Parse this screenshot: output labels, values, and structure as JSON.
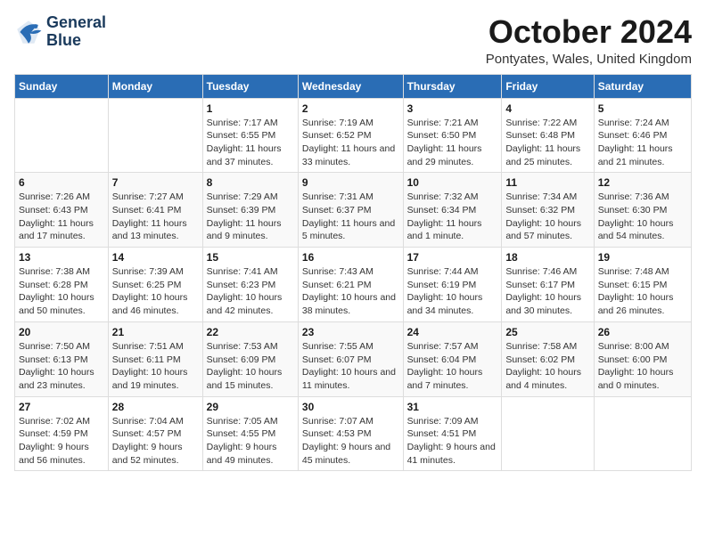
{
  "logo": {
    "line1": "General",
    "line2": "Blue"
  },
  "title": "October 2024",
  "subtitle": "Pontyates, Wales, United Kingdom",
  "days_of_week": [
    "Sunday",
    "Monday",
    "Tuesday",
    "Wednesday",
    "Thursday",
    "Friday",
    "Saturday"
  ],
  "weeks": [
    [
      {
        "day": "",
        "info": ""
      },
      {
        "day": "",
        "info": ""
      },
      {
        "day": "1",
        "info": "Sunrise: 7:17 AM\nSunset: 6:55 PM\nDaylight: 11 hours and 37 minutes."
      },
      {
        "day": "2",
        "info": "Sunrise: 7:19 AM\nSunset: 6:52 PM\nDaylight: 11 hours and 33 minutes."
      },
      {
        "day": "3",
        "info": "Sunrise: 7:21 AM\nSunset: 6:50 PM\nDaylight: 11 hours and 29 minutes."
      },
      {
        "day": "4",
        "info": "Sunrise: 7:22 AM\nSunset: 6:48 PM\nDaylight: 11 hours and 25 minutes."
      },
      {
        "day": "5",
        "info": "Sunrise: 7:24 AM\nSunset: 6:46 PM\nDaylight: 11 hours and 21 minutes."
      }
    ],
    [
      {
        "day": "6",
        "info": "Sunrise: 7:26 AM\nSunset: 6:43 PM\nDaylight: 11 hours and 17 minutes."
      },
      {
        "day": "7",
        "info": "Sunrise: 7:27 AM\nSunset: 6:41 PM\nDaylight: 11 hours and 13 minutes."
      },
      {
        "day": "8",
        "info": "Sunrise: 7:29 AM\nSunset: 6:39 PM\nDaylight: 11 hours and 9 minutes."
      },
      {
        "day": "9",
        "info": "Sunrise: 7:31 AM\nSunset: 6:37 PM\nDaylight: 11 hours and 5 minutes."
      },
      {
        "day": "10",
        "info": "Sunrise: 7:32 AM\nSunset: 6:34 PM\nDaylight: 11 hours and 1 minute."
      },
      {
        "day": "11",
        "info": "Sunrise: 7:34 AM\nSunset: 6:32 PM\nDaylight: 10 hours and 57 minutes."
      },
      {
        "day": "12",
        "info": "Sunrise: 7:36 AM\nSunset: 6:30 PM\nDaylight: 10 hours and 54 minutes."
      }
    ],
    [
      {
        "day": "13",
        "info": "Sunrise: 7:38 AM\nSunset: 6:28 PM\nDaylight: 10 hours and 50 minutes."
      },
      {
        "day": "14",
        "info": "Sunrise: 7:39 AM\nSunset: 6:25 PM\nDaylight: 10 hours and 46 minutes."
      },
      {
        "day": "15",
        "info": "Sunrise: 7:41 AM\nSunset: 6:23 PM\nDaylight: 10 hours and 42 minutes."
      },
      {
        "day": "16",
        "info": "Sunrise: 7:43 AM\nSunset: 6:21 PM\nDaylight: 10 hours and 38 minutes."
      },
      {
        "day": "17",
        "info": "Sunrise: 7:44 AM\nSunset: 6:19 PM\nDaylight: 10 hours and 34 minutes."
      },
      {
        "day": "18",
        "info": "Sunrise: 7:46 AM\nSunset: 6:17 PM\nDaylight: 10 hours and 30 minutes."
      },
      {
        "day": "19",
        "info": "Sunrise: 7:48 AM\nSunset: 6:15 PM\nDaylight: 10 hours and 26 minutes."
      }
    ],
    [
      {
        "day": "20",
        "info": "Sunrise: 7:50 AM\nSunset: 6:13 PM\nDaylight: 10 hours and 23 minutes."
      },
      {
        "day": "21",
        "info": "Sunrise: 7:51 AM\nSunset: 6:11 PM\nDaylight: 10 hours and 19 minutes."
      },
      {
        "day": "22",
        "info": "Sunrise: 7:53 AM\nSunset: 6:09 PM\nDaylight: 10 hours and 15 minutes."
      },
      {
        "day": "23",
        "info": "Sunrise: 7:55 AM\nSunset: 6:07 PM\nDaylight: 10 hours and 11 minutes."
      },
      {
        "day": "24",
        "info": "Sunrise: 7:57 AM\nSunset: 6:04 PM\nDaylight: 10 hours and 7 minutes."
      },
      {
        "day": "25",
        "info": "Sunrise: 7:58 AM\nSunset: 6:02 PM\nDaylight: 10 hours and 4 minutes."
      },
      {
        "day": "26",
        "info": "Sunrise: 8:00 AM\nSunset: 6:00 PM\nDaylight: 10 hours and 0 minutes."
      }
    ],
    [
      {
        "day": "27",
        "info": "Sunrise: 7:02 AM\nSunset: 4:59 PM\nDaylight: 9 hours and 56 minutes."
      },
      {
        "day": "28",
        "info": "Sunrise: 7:04 AM\nSunset: 4:57 PM\nDaylight: 9 hours and 52 minutes."
      },
      {
        "day": "29",
        "info": "Sunrise: 7:05 AM\nSunset: 4:55 PM\nDaylight: 9 hours and 49 minutes."
      },
      {
        "day": "30",
        "info": "Sunrise: 7:07 AM\nSunset: 4:53 PM\nDaylight: 9 hours and 45 minutes."
      },
      {
        "day": "31",
        "info": "Sunrise: 7:09 AM\nSunset: 4:51 PM\nDaylight: 9 hours and 41 minutes."
      },
      {
        "day": "",
        "info": ""
      },
      {
        "day": "",
        "info": ""
      }
    ]
  ]
}
